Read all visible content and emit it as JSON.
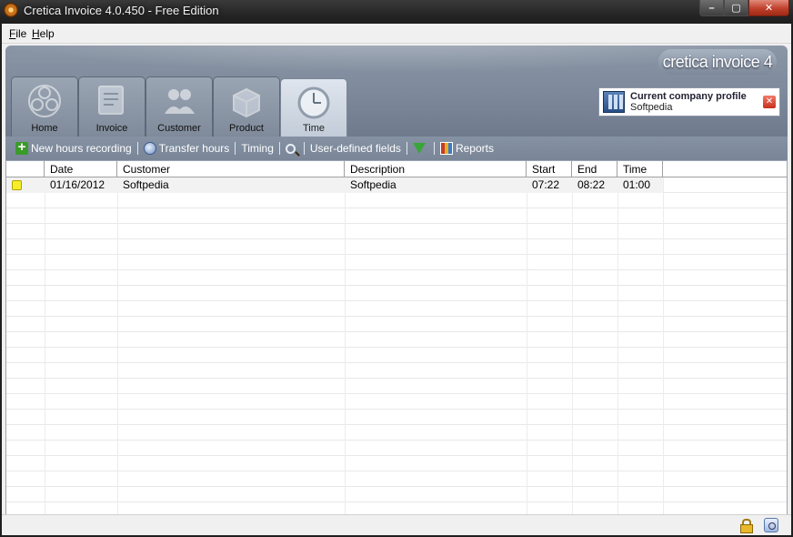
{
  "window": {
    "title": "Cretica Invoice 4.0.450 - Free Edition",
    "controls": {
      "minimize": "–",
      "maximize": "▢",
      "close": "✕"
    }
  },
  "menu": [
    {
      "label": "File",
      "accel": "F",
      "rest": "ile"
    },
    {
      "label": "Help",
      "accel": "H",
      "rest": "elp"
    }
  ],
  "brand": "cretica invoice 4",
  "tabs": [
    {
      "label": "Home",
      "icon": "flower-icon",
      "active": false
    },
    {
      "label": "Invoice",
      "icon": "invoice-icon",
      "active": false
    },
    {
      "label": "Customer",
      "icon": "customers-icon",
      "active": false
    },
    {
      "label": "Product",
      "icon": "product-box-icon",
      "active": false
    },
    {
      "label": "Time",
      "icon": "clock-icon",
      "active": true
    }
  ],
  "profile": {
    "title": "Current company profile",
    "value": "Softpedia",
    "close": "✕"
  },
  "toolbar": {
    "new_hours": "New hours recording",
    "transfer_hours": "Transfer hours",
    "timing": "Timing",
    "user_defined_fields": "User-defined fields",
    "reports": "Reports"
  },
  "grid": {
    "columns": [
      "",
      "Date",
      "Customer",
      "Description",
      "Start",
      "End",
      "Time"
    ],
    "rows": [
      {
        "marker_color": "#f7ee2a",
        "date": "01/16/2012",
        "customer": "Softpedia",
        "description": "Softpedia",
        "start": "07:22",
        "end": "08:22",
        "time": "01:00"
      }
    ]
  },
  "colors": {
    "header_bg": "#7e8a9b",
    "toolbar_bg": "#7a8698",
    "close_button": "#c0402c"
  }
}
